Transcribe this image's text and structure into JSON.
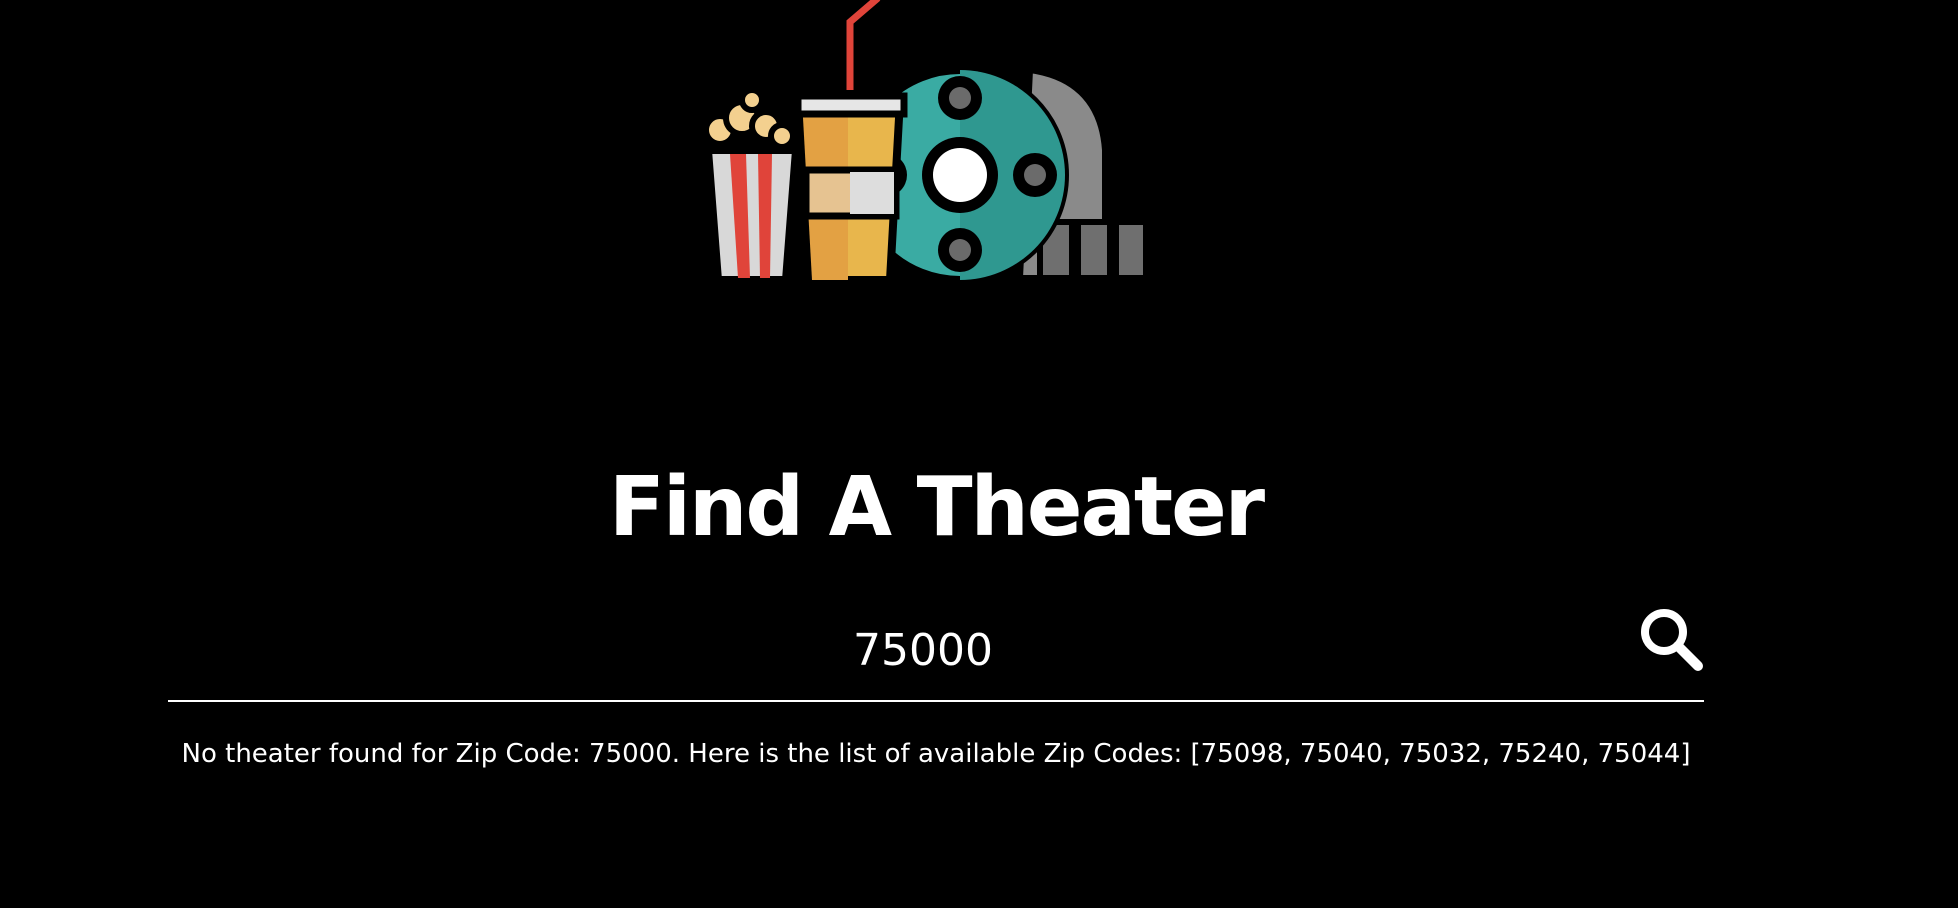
{
  "logo": {
    "icon": "cinema-logo-icon"
  },
  "page": {
    "title": "Find A Theater"
  },
  "search": {
    "value": "75000",
    "button_icon": "search-icon"
  },
  "result": {
    "message": "No theater found for Zip Code: 75000. Here is the list of available Zip Codes: [75098, 75040, 75032, 75240, 75044]"
  },
  "colors": {
    "background": "#000000",
    "text": "#ffffff",
    "popcorn_red": "#e0443a",
    "drink_yellow": "#e8b64c",
    "reel_teal": "#3aaba3",
    "film_gray": "#8a8a8a"
  }
}
